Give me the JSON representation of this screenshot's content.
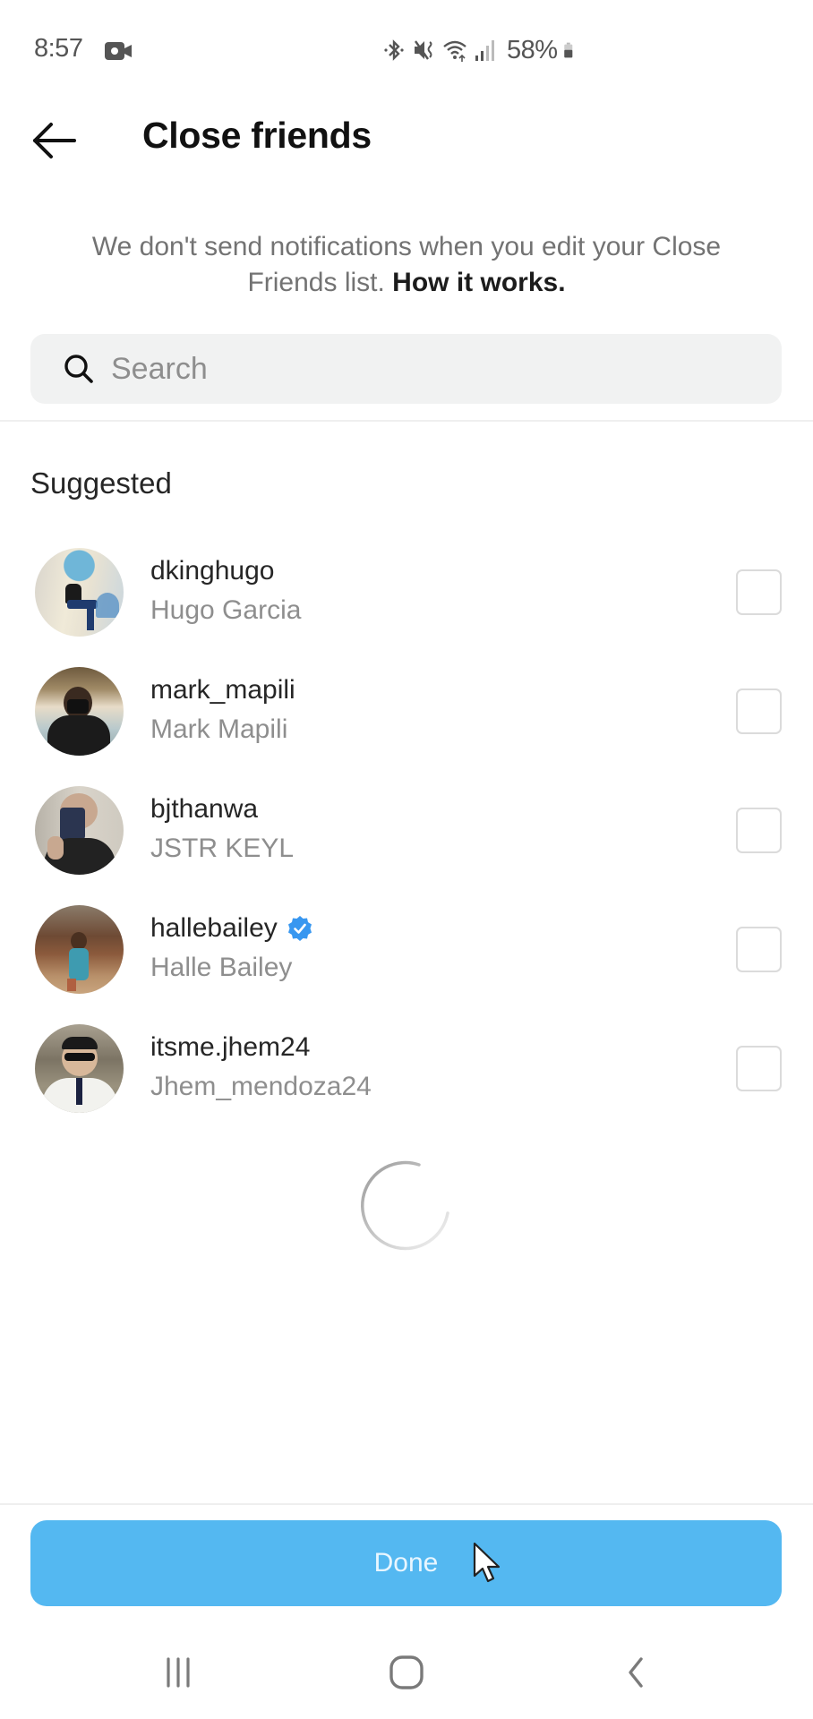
{
  "status_bar": {
    "time": "8:57",
    "battery_percent": "58%",
    "battery_level": 0.58,
    "icons": [
      "screen-record-icon",
      "bluetooth-icon",
      "vibrate-mute-icon",
      "wifi-icon",
      "signal-icon",
      "battery-icon"
    ]
  },
  "header": {
    "back_icon": "arrow-left-icon",
    "title": "Close friends"
  },
  "info": {
    "text": "We don't send notifications when you edit your Close Friends list.",
    "link": "How it works."
  },
  "search": {
    "placeholder": "Search",
    "value": "",
    "icon": "search-icon"
  },
  "section_label": "Suggested",
  "suggested": [
    {
      "username": "dkinghugo",
      "full_name": "Hugo Garcia",
      "verified": false,
      "checked": false
    },
    {
      "username": "mark_mapili",
      "full_name": "Mark Mapili",
      "verified": false,
      "checked": false
    },
    {
      "username": "bjthanwa",
      "full_name": "JSTR KEYL",
      "verified": false,
      "checked": false
    },
    {
      "username": "hallebailey",
      "full_name": "Halle Bailey",
      "verified": true,
      "checked": false
    },
    {
      "username": "itsme.jhem24",
      "full_name": "Jhem_mendoza24",
      "verified": false,
      "checked": false
    }
  ],
  "loading": true,
  "done_button": {
    "label": "Done"
  },
  "nav_bar": {
    "recents": "recents-icon",
    "home": "home-icon",
    "back": "back-icon"
  },
  "colors": {
    "accent": "#54b8f1",
    "verified": "#3897f0",
    "muted_text": "#8e8e8e",
    "primary_text": "#262626"
  }
}
